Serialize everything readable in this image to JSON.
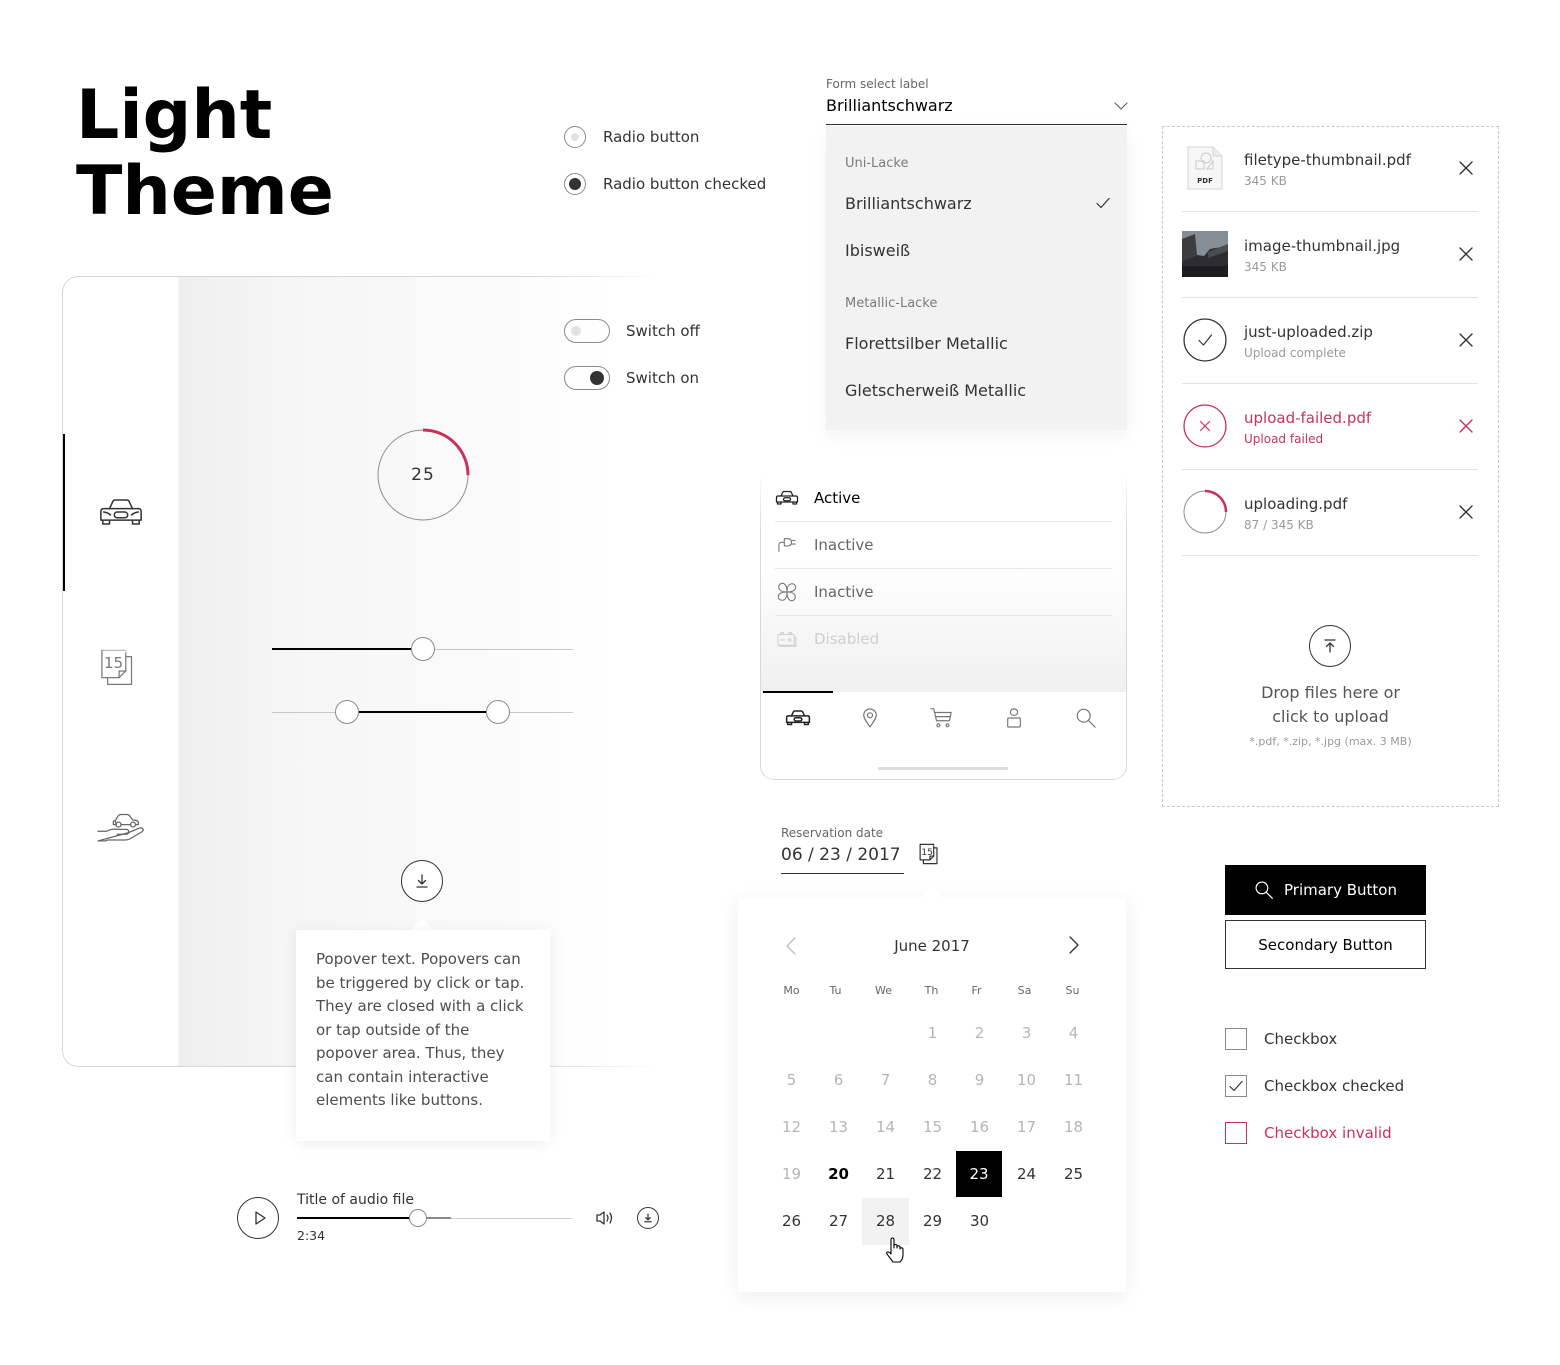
{
  "page": {
    "title_lines": [
      "Light",
      "Theme"
    ]
  },
  "theme": {
    "accent_red": "#c8325a",
    "black": "#000000",
    "text": "#333333",
    "muted": "#666666",
    "disabled": "#cccccc",
    "panel_gray": "#f2f2f2"
  },
  "radios": [
    {
      "label": "Radio button",
      "checked": false
    },
    {
      "label": "Radio button checked",
      "checked": true
    }
  ],
  "switches": [
    {
      "label": "Switch off",
      "on": false
    },
    {
      "label": "Switch on",
      "on": true
    }
  ],
  "sidebar": {
    "items": [
      {
        "icon": "car-icon",
        "active": true
      },
      {
        "icon": "calendar-icon",
        "badge": "15",
        "active": false
      },
      {
        "icon": "hand-car-icon",
        "active": false
      }
    ]
  },
  "progress": {
    "label": "25",
    "percent": 25
  },
  "slider": {
    "value_percent": 50
  },
  "range_slider": {
    "low_percent": 25,
    "high_percent": 75
  },
  "popover": {
    "trigger_icon": "download-icon",
    "text": "Popover text. Popovers can be triggered by click or tap. They are closed with a click or tap outside of the popover area. Thus, they can contain interactive elements like buttons."
  },
  "audio": {
    "title": "Title of audio file",
    "time": "2:34",
    "played_percent": 44,
    "buffered_percent": 56
  },
  "select": {
    "label": "Form select label",
    "value": "Brilliantschwarz",
    "groups": [
      {
        "label": "Uni-Lacke",
        "options": [
          {
            "label": "Brilliantschwarz",
            "selected": true
          },
          {
            "label": "Ibisweiß",
            "selected": false
          }
        ]
      },
      {
        "label": "Metallic-Lacke",
        "options": [
          {
            "label": "Florettsilber Metallic",
            "selected": false
          },
          {
            "label": "Gletscherweiß Metallic",
            "selected": false
          }
        ]
      }
    ]
  },
  "nav_list": {
    "items": [
      {
        "label": "Active",
        "icon": "car-icon",
        "state": "active"
      },
      {
        "label": "Inactive",
        "icon": "plug-icon",
        "state": "inactive"
      },
      {
        "label": "Inactive",
        "icon": "fan-icon",
        "state": "inactive"
      },
      {
        "label": "Disabled",
        "icon": "battery-icon",
        "state": "disabled"
      }
    ]
  },
  "tab_bar": {
    "active_index": 0,
    "items": [
      {
        "icon": "car-icon"
      },
      {
        "icon": "location-pin-icon"
      },
      {
        "icon": "cart-icon"
      },
      {
        "icon": "user-icon"
      },
      {
        "icon": "search-icon"
      }
    ]
  },
  "date_field": {
    "label": "Reservation date",
    "value": "06 / 23 / 2017",
    "icon_badge": "15"
  },
  "calendar": {
    "month_label": "June 2017",
    "weekdays": [
      "Mo",
      "Tu",
      "We",
      "Th",
      "Fr",
      "Sa",
      "Su"
    ],
    "first_weekday_index": 3,
    "days": [
      1,
      2,
      3,
      4,
      5,
      6,
      7,
      8,
      9,
      10,
      11,
      12,
      13,
      14,
      15,
      16,
      17,
      18,
      19,
      20,
      21,
      22,
      23,
      24,
      25,
      26,
      27,
      28,
      29,
      30
    ],
    "disabled_before": 20,
    "today": 20,
    "selected": 23,
    "hovered": 28
  },
  "uploads": {
    "items": [
      {
        "name": "filetype-thumbnail.pdf",
        "meta": "345 KB",
        "status": "done",
        "thumb": "pdf-thumbnail",
        "thumb_label": "PDF"
      },
      {
        "name": "image-thumbnail.jpg",
        "meta": "345 KB",
        "status": "done",
        "thumb": "image-thumbnail"
      },
      {
        "name": "just-uploaded.zip",
        "meta": "Upload complete",
        "status": "complete"
      },
      {
        "name": "upload-failed.pdf",
        "meta": "Upload failed",
        "status": "failed"
      },
      {
        "name": "uploading.pdf",
        "meta": "87 / 345 KB",
        "status": "uploading",
        "progress_percent": 25
      }
    ],
    "dropzone": {
      "text": "Drop files here or click to upload",
      "hint": "*.pdf, *.zip, *.jpg (max. 3 MB)"
    }
  },
  "buttons": {
    "primary_label": "Primary Button",
    "secondary_label": "Secondary Button"
  },
  "checkboxes": [
    {
      "label": "Checkbox",
      "checked": false,
      "invalid": false
    },
    {
      "label": "Checkbox checked",
      "checked": true,
      "invalid": false
    },
    {
      "label": "Checkbox invalid",
      "checked": false,
      "invalid": true
    }
  ]
}
